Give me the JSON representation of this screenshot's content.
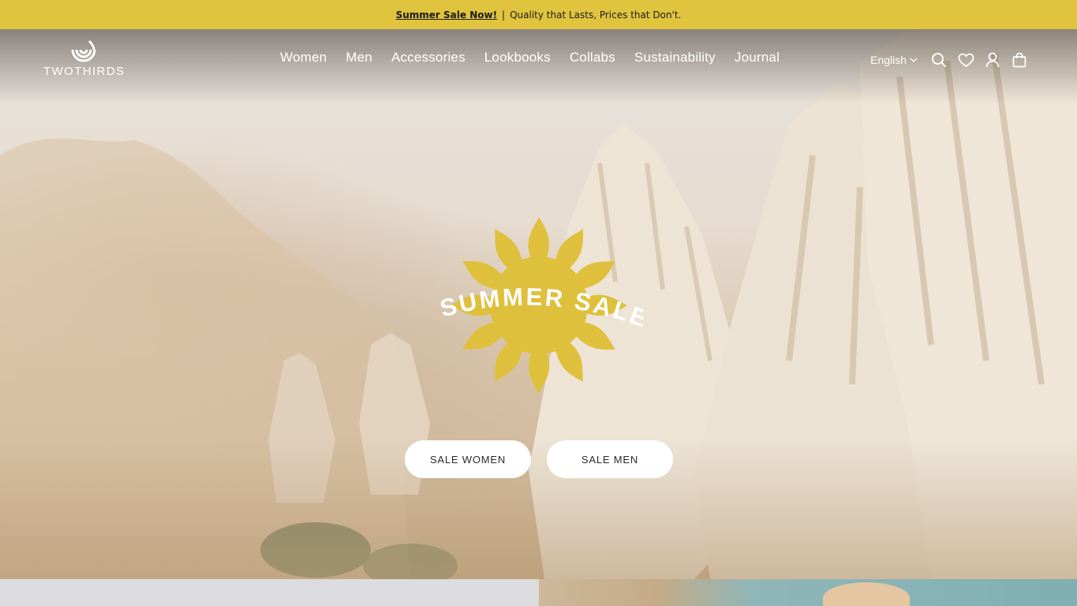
{
  "announcement": {
    "link_label": "Summer Sale Now!",
    "separator": "|",
    "text": "Quality that Lasts, Prices that Don't."
  },
  "brand": {
    "name": "TWOTHIRDS",
    "accent_color": "#e0c43e"
  },
  "nav": {
    "items": [
      "Women",
      "Men",
      "Accessories",
      "Lookbooks",
      "Collabs",
      "Sustainability",
      "Journal"
    ]
  },
  "tools": {
    "language": "English",
    "icons": [
      "chevron-down-icon",
      "search-icon",
      "heart-icon",
      "account-icon",
      "bag-icon"
    ]
  },
  "hero": {
    "badge_text": "SUMMER SALE",
    "buttons": {
      "women": "SALE WOMEN",
      "men": "SALE MEN"
    }
  }
}
